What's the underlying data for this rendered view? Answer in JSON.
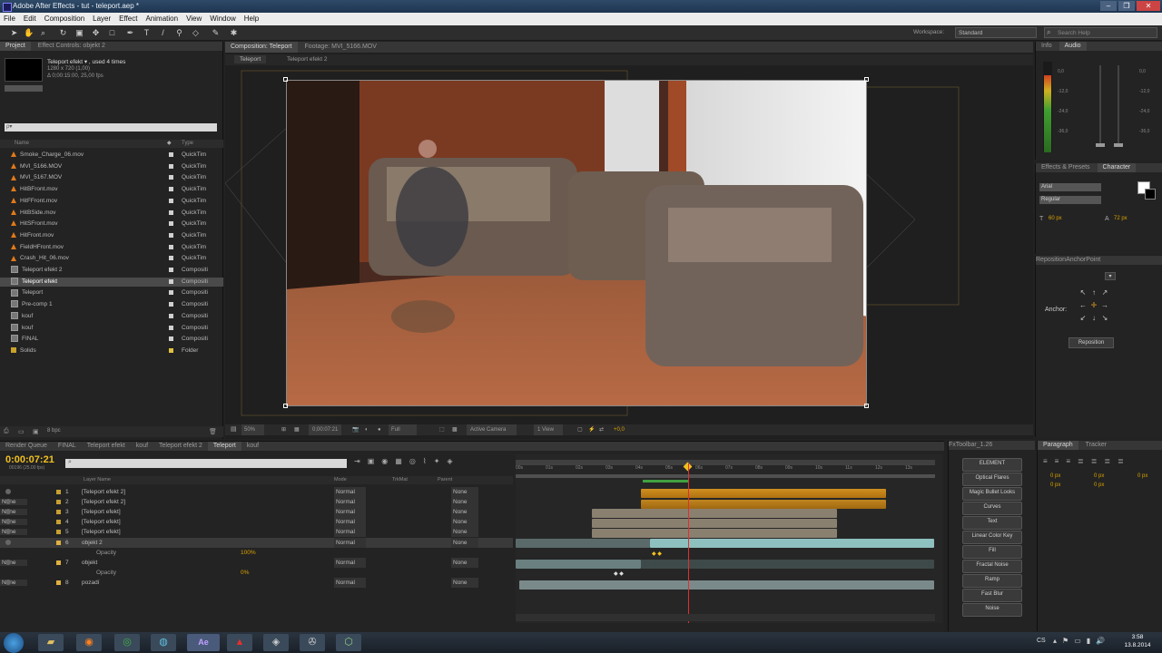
{
  "window": {
    "title": "Adobe After Effects - tut - teleport.aep *",
    "controls": [
      "–",
      "❐",
      "✕"
    ]
  },
  "menu": [
    "File",
    "Edit",
    "Composition",
    "Layer",
    "Effect",
    "Animation",
    "View",
    "Window",
    "Help"
  ],
  "toolbar": {
    "workspace_label": "Workspace:",
    "workspace_value": "Standard",
    "search_placeholder": "Search Help"
  },
  "project_panel": {
    "tabs": [
      "Project",
      "Effect Controls: objekt 2"
    ],
    "selected_name": "Teleport efekt ▾ , used 4 times",
    "selected_info_1": "1280 x 720 (1,00)",
    "selected_info_2": "Δ 0;00:15:00, 25,00 fps",
    "search_placeholder": "ρ▾",
    "columns": {
      "name": "Name",
      "type": "Type"
    },
    "items": [
      {
        "name": "Smoke_Charge_06.mov",
        "type": "QuickTim",
        "icon": "media-cone-icon",
        "swatch": "#d0d0d0"
      },
      {
        "name": "MVI_5166.MOV",
        "type": "QuickTim",
        "icon": "media-cone-icon",
        "swatch": "#d0d0d0"
      },
      {
        "name": "MVI_5167.MOV",
        "type": "QuickTim",
        "icon": "media-cone-icon",
        "swatch": "#d0d0d0"
      },
      {
        "name": "HitBFront.mov",
        "type": "QuickTim",
        "icon": "media-cone-icon",
        "swatch": "#d0d0d0"
      },
      {
        "name": "HitFFront.mov",
        "type": "QuickTim",
        "icon": "media-cone-icon",
        "swatch": "#d0d0d0"
      },
      {
        "name": "HitBSide.mov",
        "type": "QuickTim",
        "icon": "media-cone-icon",
        "swatch": "#d0d0d0"
      },
      {
        "name": "HitSFront.mov",
        "type": "QuickTim",
        "icon": "media-cone-icon",
        "swatch": "#d0d0d0"
      },
      {
        "name": "HitFront.mov",
        "type": "QuickTim",
        "icon": "media-cone-icon",
        "swatch": "#d0d0d0"
      },
      {
        "name": "FieldHFront.mov",
        "type": "QuickTim",
        "icon": "media-cone-icon",
        "swatch": "#d0d0d0"
      },
      {
        "name": "Crash_Hit_06.mov",
        "type": "QuickTim",
        "icon": "media-cone-icon",
        "swatch": "#d0d0d0"
      },
      {
        "name": "Teleport efekt 2",
        "type": "Compositi",
        "icon": "composition-icon",
        "swatch": "#d0d0d0"
      },
      {
        "name": "Teleport efekt",
        "type": "Compositi",
        "icon": "composition-icon",
        "swatch": "#d0d0d0",
        "selected": true
      },
      {
        "name": "Teleport",
        "type": "Compositi",
        "icon": "composition-icon",
        "swatch": "#d0d0d0"
      },
      {
        "name": "Pre-comp 1",
        "type": "Compositi",
        "icon": "composition-icon",
        "swatch": "#d0d0d0"
      },
      {
        "name": "kouf",
        "type": "Compositi",
        "icon": "composition-icon",
        "swatch": "#d0d0d0"
      },
      {
        "name": "kouf",
        "type": "Compositi",
        "icon": "composition-icon",
        "swatch": "#d0d0d0"
      },
      {
        "name": "FINAL",
        "type": "Compositi",
        "icon": "composition-icon",
        "swatch": "#d0d0d0"
      },
      {
        "name": "Solids",
        "type": "Folder",
        "icon": "folder-icon",
        "swatch": "#e0c040"
      }
    ],
    "footer_bpc": "8 bpc"
  },
  "comp_panel": {
    "tabs": [
      "Composition: Teleport",
      "Footage: MVI_5166.MOV"
    ],
    "breadcrumbs": [
      "Teleport",
      "Teleport efekt 2"
    ],
    "zoom": "50%",
    "timecode": "0;00:07:21",
    "resolution": "Full",
    "camera": "Active Camera",
    "views": "1 View",
    "exposure": "+0,0"
  },
  "audio_panel": {
    "tabs": [
      "Info",
      "Audio"
    ],
    "left_scale": [
      "0,0",
      "-12,0",
      "-24,0",
      "-36,0",
      "-48,0"
    ],
    "right_scale": [
      "0,0",
      "-12,0",
      "-24,0",
      "-36,0",
      "-48,0"
    ]
  },
  "character_panel": {
    "tabs": [
      "Effects & Presets",
      "Character"
    ],
    "font": "Arial",
    "style": "Regular",
    "size": "60 px",
    "leading": "72 px"
  },
  "reposition_panel": {
    "title": "RepositionAnchorPoint",
    "anchor_label": "Anchor:",
    "button": "Reposition"
  },
  "timeline": {
    "tabs": [
      "Render Queue",
      "FINAL",
      "Teleport efekt",
      "kouf",
      "Teleport efekt 2",
      "Teleport",
      "kouf"
    ],
    "active_tab": "Teleport",
    "timecode": "0:00:07:21",
    "fps": "00196 (25.00 fps)",
    "columns": {
      "layer_name": "Layer Name",
      "mode": "Mode",
      "trkmat": "TrkMat",
      "parent": "Parent"
    },
    "ruler": [
      "00s",
      "01s",
      "02s",
      "03s",
      "04s",
      "05s",
      "06s",
      "07s",
      "08s",
      "09s",
      "10s",
      "11s",
      "12s",
      "13s"
    ],
    "layers": [
      {
        "num": "1",
        "name": "[Teleport efekt 2]",
        "mode": "Normal",
        "trkmat": "",
        "parent": "None",
        "label": "#c8a030"
      },
      {
        "num": "2",
        "name": "[Teleport efekt 2]",
        "mode": "Normal",
        "trkmat": "None",
        "parent": "None",
        "label": "#c8a030"
      },
      {
        "num": "3",
        "name": "[Teleport efekt]",
        "mode": "Normal",
        "trkmat": "None",
        "parent": "None",
        "label": "#c8a030"
      },
      {
        "num": "4",
        "name": "[Teleport efekt]",
        "mode": "Normal",
        "trkmat": "None",
        "parent": "None",
        "label": "#c8a030"
      },
      {
        "num": "5",
        "name": "[Teleport efekt]",
        "mode": "Normal",
        "trkmat": "None",
        "parent": "None",
        "label": "#c8a030"
      },
      {
        "num": "6",
        "name": "objekt 2",
        "mode": "Normal",
        "trkmat": "",
        "parent": "None",
        "label": "#e0b040"
      },
      {
        "num": "",
        "name": "Opacity",
        "value": "100%"
      },
      {
        "num": "7",
        "name": "objekt",
        "mode": "Normal",
        "trkmat": "None",
        "parent": "None",
        "label": "#e0b040"
      },
      {
        "num": "",
        "name": "Opacity",
        "value": "0%"
      },
      {
        "num": "8",
        "name": "pozadí",
        "mode": "Normal",
        "trkmat": "None",
        "parent": "None",
        "label": "#e0b040"
      }
    ]
  },
  "preset_panel": {
    "title": "FxToolbar_1.26",
    "buttons": [
      "ELEMENT",
      "Optical Flares",
      "Magic Bullet Looks",
      "Curves",
      "Text",
      "Linear Color Key",
      "Fill",
      "Fractal Noise",
      "Ramp",
      "Fast Blur",
      "Noise"
    ]
  },
  "paragraph_panel": {
    "tabs": [
      "Paragraph",
      "Tracker"
    ],
    "values": [
      "0 px",
      "0 px",
      "0 px",
      "0 px",
      "0 px"
    ]
  },
  "taskbar": {
    "lang": "CS",
    "time": "3:58",
    "date": "13.8.2014"
  },
  "colors": {
    "accent_orange": "#e8a020",
    "cti_red": "#e03030",
    "timecode_yellow": "#f0c020"
  }
}
